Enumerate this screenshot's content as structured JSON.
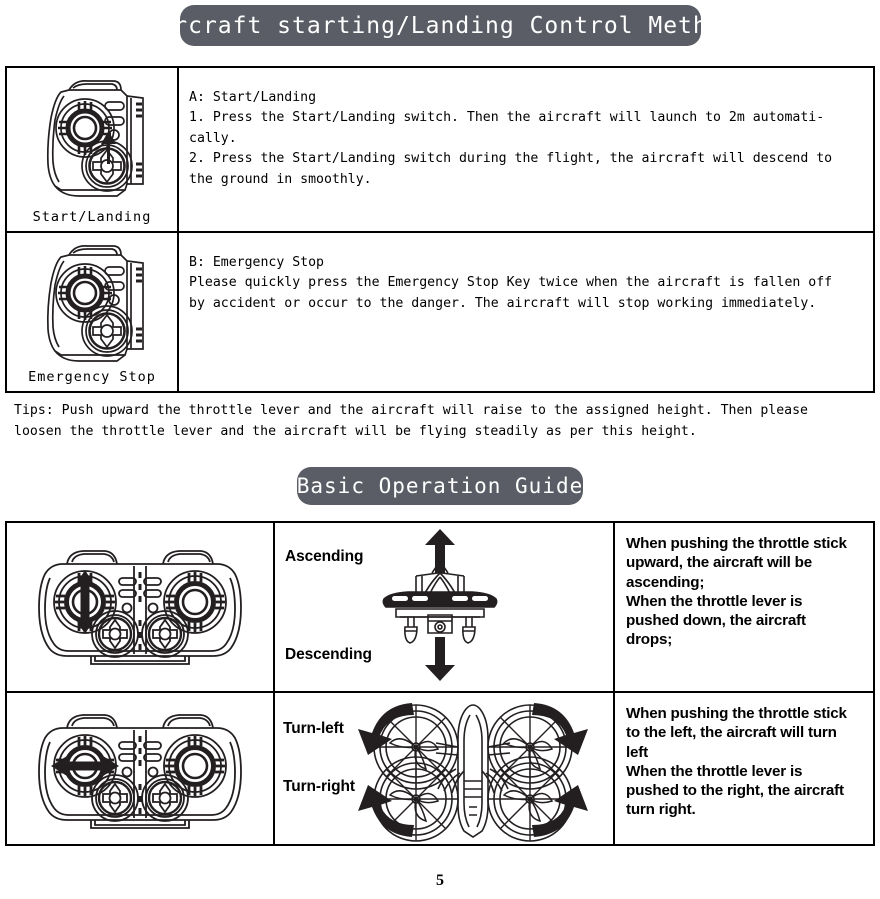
{
  "banners": {
    "main": "Aircraft starting/Landing Control Method",
    "basic": "Basic Operation Guide"
  },
  "upper_table": {
    "rows": [
      {
        "caption": "Start/Landing",
        "icon": "remote-half-with-up-arrow",
        "text": "A: Start/Landing\n1. Press the Start/Landing switch. Then the aircraft will launch to 2m automati-\ncally.\n2. Press the Start/Landing switch during the flight, the aircraft will descend to\nthe ground in smoothly."
      },
      {
        "caption": "Emergency Stop",
        "icon": "remote-half-plain",
        "text": "B: Emergency Stop\nPlease quickly press the Emergency Stop Key twice when the aircraft is fallen off\nby accident or occur to the danger. The aircraft will stop working immediately."
      }
    ]
  },
  "tips": "Tips: Push upward the throttle lever and the aircraft will raise to the assigned height. Then please\nloosen the throttle lever and the aircraft will be flying steadily as per this height.",
  "lower_table": {
    "rows": [
      {
        "remote_icon": "remote-full-vertical-arrow",
        "diagram_icon": "drone-side-view",
        "label_top": "Ascending",
        "label_bottom": "Descending",
        "description": "When pushing the throttle stick\nupward, the aircraft will be\nascending;\nWhen the throttle lever is\npushed down, the aircraft\ndrops;"
      },
      {
        "remote_icon": "remote-full-horizontal-arrow",
        "diagram_icon": "drone-top-view",
        "label_top": "Turn-left",
        "label_bottom": "Turn-right",
        "description": "When pushing the throttle stick\nto the left, the aircraft will turn\nleft\nWhen the throttle lever is\npushed to the right, the aircraft\nturn right."
      }
    ]
  },
  "page_number": "5",
  "colors": {
    "banner_background": "#5a5d66",
    "banner_text": "#ffffff",
    "line_art": "#231f20",
    "border": "#000000"
  }
}
